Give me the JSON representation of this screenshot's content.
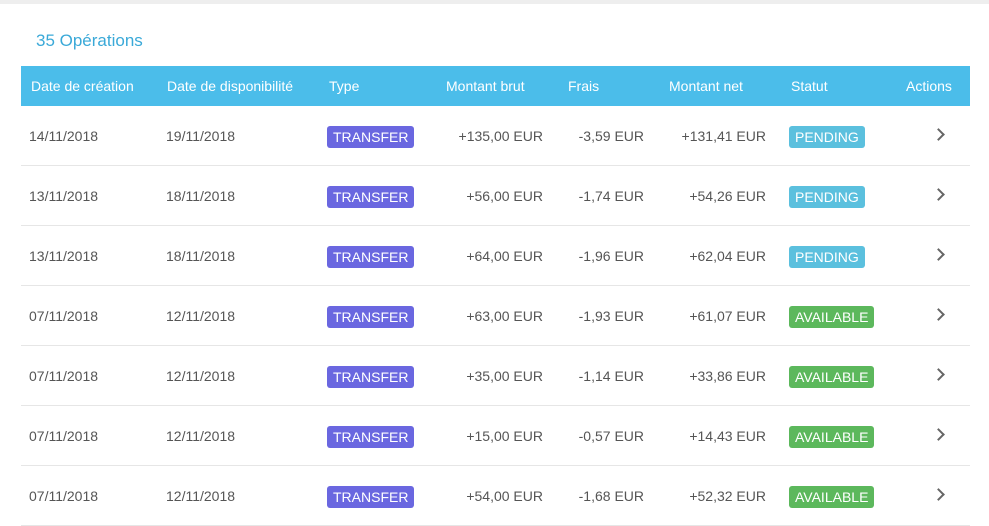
{
  "title": "35 Opérations",
  "columns": {
    "created": "Date de création",
    "available": "Date de disponibilité",
    "type": "Type",
    "gross": "Montant brut",
    "fees": "Frais",
    "net": "Montant net",
    "status": "Statut",
    "actions": "Actions"
  },
  "colors": {
    "header_bg": "#4bbdea",
    "title": "#3aa9d8",
    "type_badge": "#6a67e0",
    "pending_badge": "#5bc0de",
    "available_badge": "#5cb85c"
  },
  "rows": [
    {
      "created": "14/11/2018",
      "available": "19/11/2018",
      "type": "TRANSFER",
      "gross": "+135,00 EUR",
      "fees": "-3,59 EUR",
      "net": "+131,41 EUR",
      "status": "PENDING",
      "action_icon": "chevron-right-icon"
    },
    {
      "created": "13/11/2018",
      "available": "18/11/2018",
      "type": "TRANSFER",
      "gross": "+56,00 EUR",
      "fees": "-1,74 EUR",
      "net": "+54,26 EUR",
      "status": "PENDING",
      "action_icon": "chevron-right-icon"
    },
    {
      "created": "13/11/2018",
      "available": "18/11/2018",
      "type": "TRANSFER",
      "gross": "+64,00 EUR",
      "fees": "-1,96 EUR",
      "net": "+62,04 EUR",
      "status": "PENDING",
      "action_icon": "chevron-right-icon"
    },
    {
      "created": "07/11/2018",
      "available": "12/11/2018",
      "type": "TRANSFER",
      "gross": "+63,00 EUR",
      "fees": "-1,93 EUR",
      "net": "+61,07 EUR",
      "status": "AVAILABLE",
      "action_icon": "chevron-right-icon"
    },
    {
      "created": "07/11/2018",
      "available": "12/11/2018",
      "type": "TRANSFER",
      "gross": "+35,00 EUR",
      "fees": "-1,14 EUR",
      "net": "+33,86 EUR",
      "status": "AVAILABLE",
      "action_icon": "chevron-right-icon"
    },
    {
      "created": "07/11/2018",
      "available": "12/11/2018",
      "type": "TRANSFER",
      "gross": "+15,00 EUR",
      "fees": "-0,57 EUR",
      "net": "+14,43 EUR",
      "status": "AVAILABLE",
      "action_icon": "chevron-right-icon"
    },
    {
      "created": "07/11/2018",
      "available": "12/11/2018",
      "type": "TRANSFER",
      "gross": "+54,00 EUR",
      "fees": "-1,68 EUR",
      "net": "+52,32 EUR",
      "status": "AVAILABLE",
      "action_icon": "chevron-right-icon"
    }
  ]
}
